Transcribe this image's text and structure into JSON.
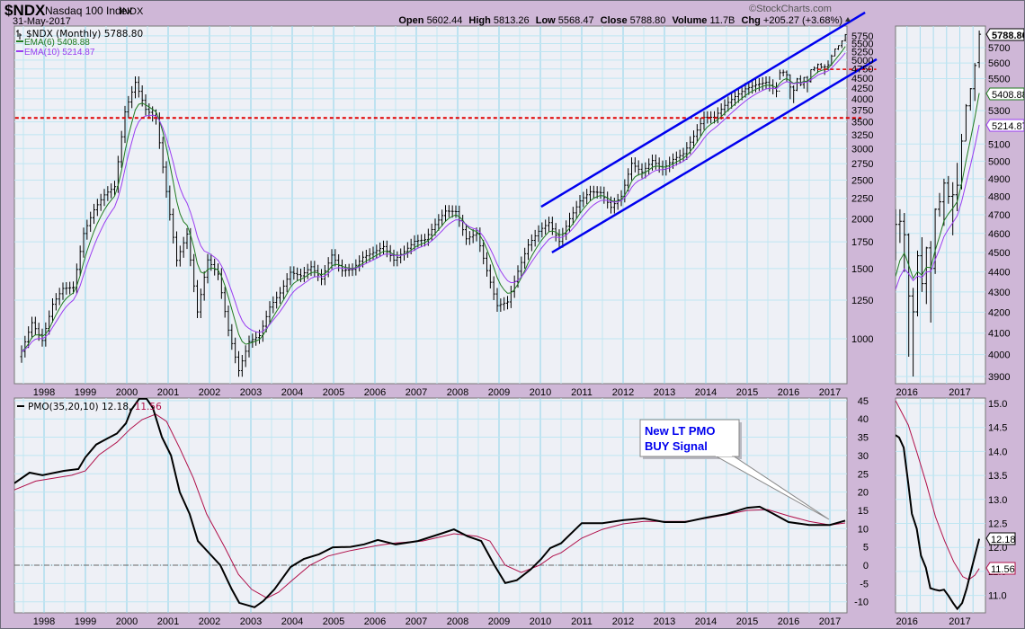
{
  "header": {
    "symbol": "$NDX",
    "name": "Nasdaq 100 Index",
    "exchange": "INDX",
    "date": "31-May-2017",
    "watermark": "©StockCharts.com",
    "quote": {
      "open_label": "Open",
      "open": "5602.44",
      "high_label": "High",
      "high": "5813.26",
      "low_label": "Low",
      "low": "5568.47",
      "close_label": "Close",
      "close": "5788.80",
      "volume_label": "Volume",
      "volume": "11.7B",
      "chg_label": "Chg",
      "chg": "+205.27 (+3.68%)"
    }
  },
  "legend": {
    "price": "$NDX (Monthly) 5788.80",
    "ema6": "EMA(6) 5408.88",
    "ema10": "EMA(10) 5214.87",
    "pmo": "PMO(35,20,10) 12.18,",
    "pmo_signal": "11.56"
  },
  "annotation": {
    "line1": "New LT PMO",
    "line2": "BUY Signal"
  },
  "tags": {
    "last_close": "5788.80",
    "ema6": "5408.88",
    "ema10": "5214.87",
    "pmo": "12.18",
    "pmo_signal": "11.56"
  },
  "colors": {
    "background": "#cfb7d7",
    "panel": "#eef0f6",
    "grid": "#addff0",
    "bars": "#000000",
    "ema6": "#1f7a1f",
    "ema10": "#9a3cf0",
    "pmo": "#000000",
    "pmo_signal": "#b0104a",
    "channel": "#0000ee",
    "support": "#e00000",
    "annotation_text": "#0000ee"
  },
  "chart_data": [
    {
      "id": "price-main",
      "type": "ohlc",
      "title": "$NDX (Monthly)",
      "scale": "log",
      "ylim": [
        880,
        5900
      ],
      "y_ticks": [
        1000,
        1250,
        1500,
        1750,
        2000,
        2250,
        2500,
        2750,
        3000,
        3250,
        3500,
        3750,
        4000,
        4250,
        4500,
        4750,
        5000,
        5250,
        5500,
        5750
      ],
      "x_ticks": [
        1998,
        1999,
        2000,
        2001,
        2002,
        2003,
        2004,
        2005,
        2006,
        2007,
        2008,
        2009,
        2010,
        2011,
        2012,
        2013,
        2014,
        2015,
        2016,
        2017
      ],
      "ema_periods": [
        6,
        10
      ],
      "quarterly_closes": [
        [
          "1997-06",
          930
        ],
        [
          "1997-09",
          1097
        ],
        [
          "1997-12",
          990
        ],
        [
          "1998-03",
          1220
        ],
        [
          "1998-06",
          1337
        ],
        [
          "1998-09",
          1345
        ],
        [
          "1998-12",
          1836
        ],
        [
          "1999-03",
          2106
        ],
        [
          "1999-06",
          2296
        ],
        [
          "1999-09",
          2407
        ],
        [
          "1999-12",
          3708
        ],
        [
          "2000-03",
          4398
        ],
        [
          "2000-06",
          3763
        ],
        [
          "2000-09",
          3570
        ],
        [
          "2000-12",
          2341
        ],
        [
          "2001-03",
          1573
        ],
        [
          "2001-06",
          1830
        ],
        [
          "2001-09",
          1168
        ],
        [
          "2001-12",
          1577
        ],
        [
          "2002-03",
          1453
        ],
        [
          "2002-06",
          1051
        ],
        [
          "2002-09",
          832
        ],
        [
          "2002-12",
          984
        ],
        [
          "2003-03",
          1018
        ],
        [
          "2003-06",
          1201
        ],
        [
          "2003-09",
          1303
        ],
        [
          "2003-12",
          1468
        ],
        [
          "2004-03",
          1438
        ],
        [
          "2004-06",
          1516
        ],
        [
          "2004-09",
          1412
        ],
        [
          "2004-12",
          1621
        ],
        [
          "2005-03",
          1483
        ],
        [
          "2005-06",
          1493
        ],
        [
          "2005-09",
          1601
        ],
        [
          "2005-12",
          1645
        ],
        [
          "2006-03",
          1703
        ],
        [
          "2006-06",
          1575
        ],
        [
          "2006-09",
          1654
        ],
        [
          "2006-12",
          1756
        ],
        [
          "2007-03",
          1772
        ],
        [
          "2007-06",
          1934
        ],
        [
          "2007-09",
          2091
        ],
        [
          "2007-12",
          2084
        ],
        [
          "2008-03",
          1781
        ],
        [
          "2008-06",
          1837
        ],
        [
          "2008-09",
          1483
        ],
        [
          "2008-12",
          1211
        ],
        [
          "2009-03",
          1237
        ],
        [
          "2009-06",
          1477
        ],
        [
          "2009-09",
          1719
        ],
        [
          "2009-12",
          1860
        ],
        [
          "2010-03",
          1956
        ],
        [
          "2010-06",
          1754
        ],
        [
          "2010-09",
          2000
        ],
        [
          "2010-12",
          2217
        ],
        [
          "2011-03",
          2338
        ],
        [
          "2011-06",
          2325
        ],
        [
          "2011-09",
          2136
        ],
        [
          "2011-12",
          2278
        ],
        [
          "2012-03",
          2755
        ],
        [
          "2012-06",
          2616
        ],
        [
          "2012-09",
          2799
        ],
        [
          "2012-12",
          2660
        ],
        [
          "2013-03",
          2818
        ],
        [
          "2013-06",
          2910
        ],
        [
          "2013-09",
          3218
        ],
        [
          "2013-12",
          3592
        ],
        [
          "2014-03",
          3596
        ],
        [
          "2014-06",
          3850
        ],
        [
          "2014-09",
          4050
        ],
        [
          "2014-12",
          4236
        ],
        [
          "2015-03",
          4334
        ],
        [
          "2015-06",
          4397
        ],
        [
          "2015-09",
          4181
        ]
      ],
      "monthly_bars_hlc": [
        [
          "2015-10",
          4730,
          4460,
          4648
        ],
        [
          "2015-11",
          4730,
          4550,
          4665
        ],
        [
          "2015-12",
          4710,
          4400,
          4593
        ],
        [
          "2016-01",
          4600,
          3990,
          4280
        ],
        [
          "2016-02",
          4320,
          3900,
          4202
        ],
        [
          "2016-03",
          4510,
          4180,
          4483
        ],
        [
          "2016-04",
          4580,
          4300,
          4341
        ],
        [
          "2016-05",
          4530,
          4240,
          4524
        ],
        [
          "2016-06",
          4560,
          4150,
          4418
        ],
        [
          "2016-07",
          4735,
          4390,
          4730
        ],
        [
          "2016-08",
          4820,
          4690,
          4771
        ],
        [
          "2016-09",
          4900,
          4640,
          4875
        ],
        [
          "2016-10",
          4915,
          4760,
          4801
        ],
        [
          "2016-11",
          4880,
          4590,
          4810
        ],
        [
          "2016-12",
          4990,
          4720,
          4863
        ],
        [
          "2017-01",
          5160,
          4840,
          5117
        ],
        [
          "2017-02",
          5340,
          5120,
          5330
        ],
        [
          "2017-03",
          5440,
          5300,
          5436
        ],
        [
          "2017-04",
          5600,
          5360,
          5584
        ],
        [
          "2017-05",
          5813.26,
          5568.47,
          5788.8
        ]
      ],
      "annotations": {
        "channel_upper": [
          [
            2010.02,
            2144
          ],
          [
            2017.85,
            6580
          ]
        ],
        "channel_lower": [
          [
            2010.28,
            1646
          ],
          [
            2018.13,
            5023
          ]
        ],
        "support_3500": [
          [
            1997.3,
            3580
          ],
          [
            2017.76,
            3580
          ]
        ],
        "support_4750": [
          [
            2016.7,
            4740
          ],
          [
            2018.12,
            4740
          ]
        ]
      }
    },
    {
      "id": "pmo-main",
      "type": "line",
      "title": "PMO(35,20,10)",
      "ylim": [
        -12,
        46
      ],
      "y_ticks": [
        45,
        40,
        35,
        30,
        25,
        20,
        15,
        10,
        5,
        0,
        -5,
        -10
      ],
      "zero_line": 0,
      "series": [
        {
          "name": "PMO",
          "values": [
            [
              1997.28,
              22.4
            ],
            [
              1997.65,
              25.3
            ],
            [
              1997.96,
              24.6
            ],
            [
              1998.48,
              25.8
            ],
            [
              1998.83,
              26.3
            ],
            [
              1999.0,
              29.5
            ],
            [
              1999.26,
              33
            ],
            [
              1999.52,
              34.6
            ],
            [
              1999.76,
              36
            ],
            [
              1999.98,
              38.8
            ],
            [
              2000.11,
              42.5
            ],
            [
              2000.3,
              45.5
            ],
            [
              2000.48,
              45.5
            ],
            [
              2000.63,
              43
            ],
            [
              2000.85,
              35
            ],
            [
              2001.07,
              30
            ],
            [
              2001.28,
              20
            ],
            [
              2001.52,
              14
            ],
            [
              2001.72,
              6.6
            ],
            [
              2002.0,
              3.2
            ],
            [
              2002.26,
              0
            ],
            [
              2002.54,
              -6.6
            ],
            [
              2002.72,
              -10.3
            ],
            [
              2003.09,
              -11.5
            ],
            [
              2003.3,
              -9.8
            ],
            [
              2003.57,
              -6.6
            ],
            [
              2003.96,
              -0.5
            ],
            [
              2004.28,
              1.7
            ],
            [
              2004.65,
              3
            ],
            [
              2004.98,
              4.9
            ],
            [
              2005.41,
              5
            ],
            [
              2005.74,
              5.7
            ],
            [
              2006.07,
              6.9
            ],
            [
              2006.5,
              5.7
            ],
            [
              2007.04,
              6.6
            ],
            [
              2007.59,
              8.6
            ],
            [
              2007.91,
              9.8
            ],
            [
              2008.24,
              7.9
            ],
            [
              2008.57,
              6.6
            ],
            [
              2008.89,
              0
            ],
            [
              2009.15,
              -4.9
            ],
            [
              2009.43,
              -4.1
            ],
            [
              2009.76,
              -1.2
            ],
            [
              2010.02,
              1.7
            ],
            [
              2010.24,
              4.7
            ],
            [
              2010.5,
              6
            ],
            [
              2011.0,
              11.5
            ],
            [
              2011.5,
              11.5
            ],
            [
              2012.0,
              12.3
            ],
            [
              2012.5,
              12.8
            ],
            [
              2013.0,
              11.8
            ],
            [
              2013.5,
              11.8
            ],
            [
              2014.0,
              13
            ],
            [
              2014.5,
              14
            ],
            [
              2015.0,
              15.7
            ],
            [
              2015.3,
              16
            ],
            [
              2015.61,
              14.2
            ],
            [
              2016.0,
              11.8
            ],
            [
              2016.5,
              11
            ],
            [
              2017.0,
              11
            ],
            [
              2017.37,
              12.18
            ]
          ]
        },
        {
          "name": "Signal",
          "values": [
            [
              1997.28,
              20.6
            ],
            [
              1997.8,
              23
            ],
            [
              1998.67,
              24.6
            ],
            [
              1999.0,
              25.8
            ],
            [
              1999.33,
              30.2
            ],
            [
              1999.76,
              33.6
            ],
            [
              2000.09,
              37.3
            ],
            [
              2000.37,
              39.8
            ],
            [
              2000.7,
              41.3
            ],
            [
              2000.96,
              39.3
            ],
            [
              2001.28,
              32
            ],
            [
              2001.61,
              23.8
            ],
            [
              2001.93,
              14
            ],
            [
              2002.37,
              4.9
            ],
            [
              2002.7,
              -2.5
            ],
            [
              2003.02,
              -6.6
            ],
            [
              2003.39,
              -9
            ],
            [
              2003.67,
              -7.4
            ],
            [
              2004.0,
              -4.1
            ],
            [
              2004.43,
              0
            ],
            [
              2004.87,
              2.5
            ],
            [
              2005.41,
              4
            ],
            [
              2006.07,
              5.4
            ],
            [
              2006.5,
              6.1
            ],
            [
              2007.15,
              6.6
            ],
            [
              2007.91,
              8.6
            ],
            [
              2008.46,
              7.9
            ],
            [
              2008.78,
              6.6
            ],
            [
              2009.15,
              0
            ],
            [
              2009.54,
              -2
            ],
            [
              2009.98,
              0
            ],
            [
              2010.3,
              2.5
            ],
            [
              2010.5,
              3.4
            ],
            [
              2011.0,
              7.4
            ],
            [
              2011.5,
              9.8
            ],
            [
              2012.0,
              11.3
            ],
            [
              2012.5,
              12
            ],
            [
              2013.0,
              12
            ],
            [
              2013.5,
              12
            ],
            [
              2014.0,
              12.8
            ],
            [
              2014.5,
              13.8
            ],
            [
              2015.0,
              15
            ],
            [
              2015.5,
              15.2
            ],
            [
              2016.0,
              13.5
            ],
            [
              2016.5,
              12
            ],
            [
              2017.0,
              11
            ],
            [
              2017.37,
              11.56
            ]
          ]
        }
      ]
    },
    {
      "id": "price-zoom",
      "type": "ohlc",
      "title": "$NDX last 20 months",
      "scale": "log",
      "ylim": [
        3880,
        5830
      ],
      "y_ticks": [
        3900,
        4000,
        4100,
        4200,
        4300,
        4400,
        4500,
        4600,
        4700,
        4800,
        4900,
        5000,
        5100,
        5300,
        5500,
        5600,
        5700
      ],
      "x_ticks": [
        2016,
        2017
      ]
    },
    {
      "id": "pmo-zoom",
      "type": "line",
      "ylim": [
        10.6,
        15.1
      ],
      "y_ticks": [
        15.0,
        14.5,
        14.0,
        13.5,
        13.0,
        12.5,
        12.0,
        11.5,
        11.0
      ],
      "x_ticks": [
        2016,
        2017
      ],
      "x_unit": "months since Oct 2015",
      "series": [
        {
          "name": "PMO",
          "values": [
            [
              0,
              14.34
            ],
            [
              0.82,
              14.29
            ],
            [
              1.86,
              14.08
            ],
            [
              2.89,
              13.33
            ],
            [
              3.71,
              12.7
            ],
            [
              4.81,
              12.39
            ],
            [
              5.77,
              11.83
            ],
            [
              6.87,
              11.58
            ],
            [
              7.9,
              11.15
            ],
            [
              8.93,
              11.12
            ],
            [
              9.97,
              11.1
            ],
            [
              11,
              11.12
            ],
            [
              12.03,
              10.99
            ],
            [
              13.06,
              10.84
            ],
            [
              14.02,
              10.72
            ],
            [
              15.12,
              10.84
            ],
            [
              16.15,
              11.14
            ],
            [
              17.32,
              11.58
            ],
            [
              19,
              12.18
            ]
          ]
        },
        {
          "name": "Signal",
          "values": [
            [
              0,
              15.06
            ],
            [
              2.89,
              14.55
            ],
            [
              4.95,
              13.95
            ],
            [
              7.01,
              13.33
            ],
            [
              9.07,
              12.64
            ],
            [
              11.13,
              12.14
            ],
            [
              13.2,
              11.7
            ],
            [
              15.26,
              11.39
            ],
            [
              16.63,
              11.33
            ],
            [
              18,
              11.42
            ],
            [
              19,
              11.56
            ]
          ]
        }
      ]
    }
  ]
}
